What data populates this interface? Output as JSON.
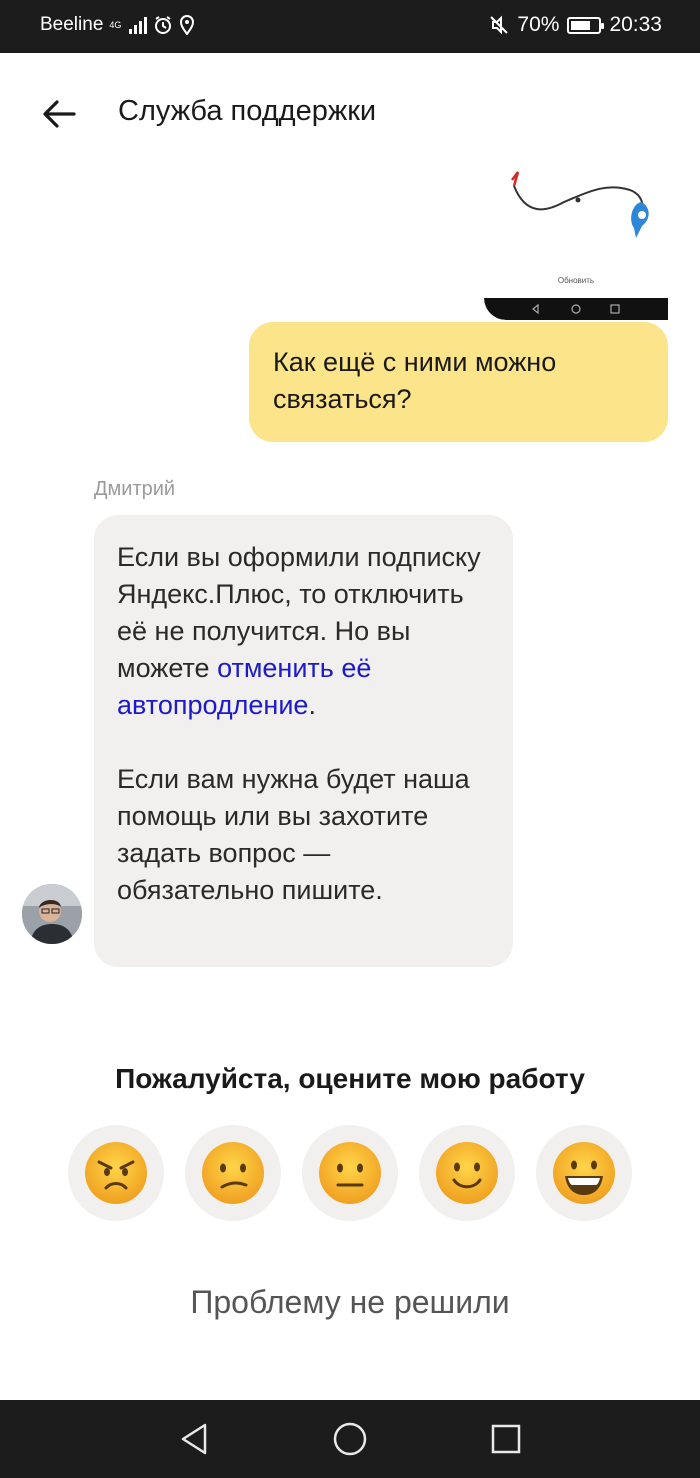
{
  "status_bar": {
    "carrier": "Beeline",
    "network": "4G",
    "battery": "70%",
    "battery_level": 0.7,
    "time": "20:33",
    "icons": [
      "signal-icon",
      "alarm-icon",
      "location-icon",
      "mute-icon",
      "battery-icon"
    ]
  },
  "header": {
    "title": "Служба поддержки",
    "back_icon": "arrow-left-icon"
  },
  "attachment": {
    "caption": "Обновить"
  },
  "messages": [
    {
      "from": "user",
      "text": "Как ещё с ними можно связаться?"
    },
    {
      "from": "support",
      "sender": "Дмитрий",
      "paragraph1_text": "Если вы оформили подписку Яндекс.Плюс, то отключить её не получится. Но вы можете",
      "paragraph1_link": "отменить её автопродление",
      "paragraph1_end": ".",
      "paragraph2": "Если вам нужна будет наша помощь или вы захотите задать вопрос — обязательно пишите."
    }
  ],
  "rating": {
    "title": "Пожалуйста, оцените мою работу",
    "options": [
      {
        "icon": "angry-face-icon",
        "value": 1
      },
      {
        "icon": "confused-face-icon",
        "value": 2
      },
      {
        "icon": "neutral-face-icon",
        "value": 3
      },
      {
        "icon": "slightly-smiling-face-icon",
        "value": 4
      },
      {
        "icon": "grinning-face-icon",
        "value": 5
      }
    ]
  },
  "actions": {
    "not_solved_label": "Проблему не решили"
  },
  "colors": {
    "user_bubble": "#fce48a",
    "support_bubble": "#f1f0ee",
    "link": "#1d1ac7",
    "status_bar": "#1c1c1c"
  }
}
